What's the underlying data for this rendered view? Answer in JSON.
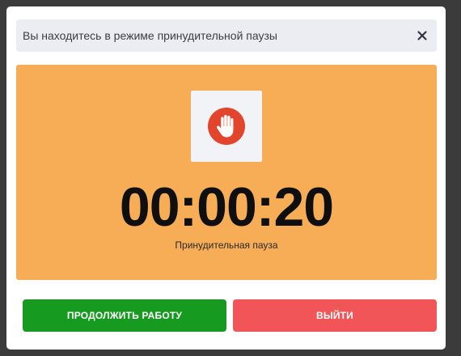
{
  "dialog": {
    "title": "Вы находитесь в режиме принудительной паузы",
    "close_icon": "close-icon"
  },
  "pause": {
    "icon": "stop-hand-icon",
    "timer": "00:00:20",
    "caption": "Принудительная пауза",
    "panel_color": "#f6ad56"
  },
  "actions": {
    "continue_label": "ПРОДОЛЖИТЬ РАБОТУ",
    "exit_label": "ВЫЙТИ",
    "continue_color": "#179a20",
    "exit_color": "#f25558"
  }
}
